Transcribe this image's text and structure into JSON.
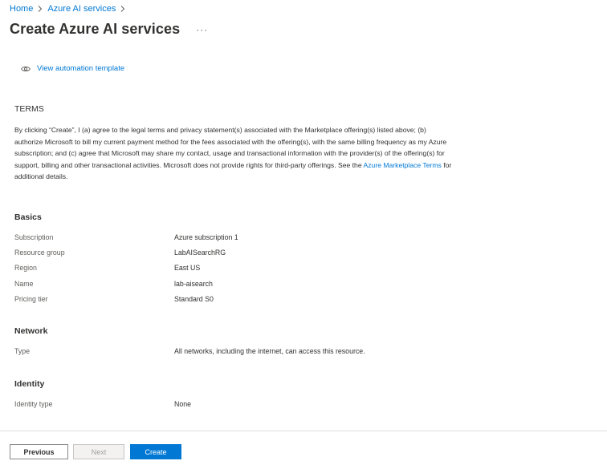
{
  "breadcrumb": {
    "items": [
      "Home",
      "Azure AI services"
    ]
  },
  "page": {
    "title": "Create Azure AI services",
    "more_label": "···"
  },
  "automation": {
    "label": "View automation template"
  },
  "terms": {
    "heading": "TERMS",
    "text_before_link": "By clicking “Create”, I (a) agree to the legal terms and privacy statement(s) associated with the Marketplace offering(s) listed above; (b) authorize Microsoft to bill my current payment method for the fees associated with the offering(s), with the same billing frequency as my Azure subscription; and (c) agree that Microsoft may share my contact, usage and transactional information with the provider(s) of the offering(s) for support, billing and other transactional activities. Microsoft does not provide rights for third-party offerings. See the ",
    "link_text": "Azure Marketplace Terms",
    "text_after_link": " for additional details."
  },
  "basics": {
    "heading": "Basics",
    "rows": [
      {
        "key": "Subscription",
        "value": "Azure subscription 1"
      },
      {
        "key": "Resource group",
        "value": "LabAISearchRG"
      },
      {
        "key": "Region",
        "value": "East US"
      },
      {
        "key": "Name",
        "value": "lab-aisearch"
      },
      {
        "key": "Pricing tier",
        "value": "Standard S0"
      }
    ]
  },
  "network": {
    "heading": "Network",
    "rows": [
      {
        "key": "Type",
        "value": "All networks, including the internet, can access this resource."
      }
    ]
  },
  "identity": {
    "heading": "Identity",
    "rows": [
      {
        "key": "Identity type",
        "value": "None"
      }
    ]
  },
  "footer": {
    "previous_label": "Previous",
    "next_label": "Next",
    "create_label": "Create"
  },
  "colors": {
    "accent": "#0078d4",
    "text": "#323130",
    "muted": "#605e5c",
    "divider": "#e1dfdd"
  }
}
